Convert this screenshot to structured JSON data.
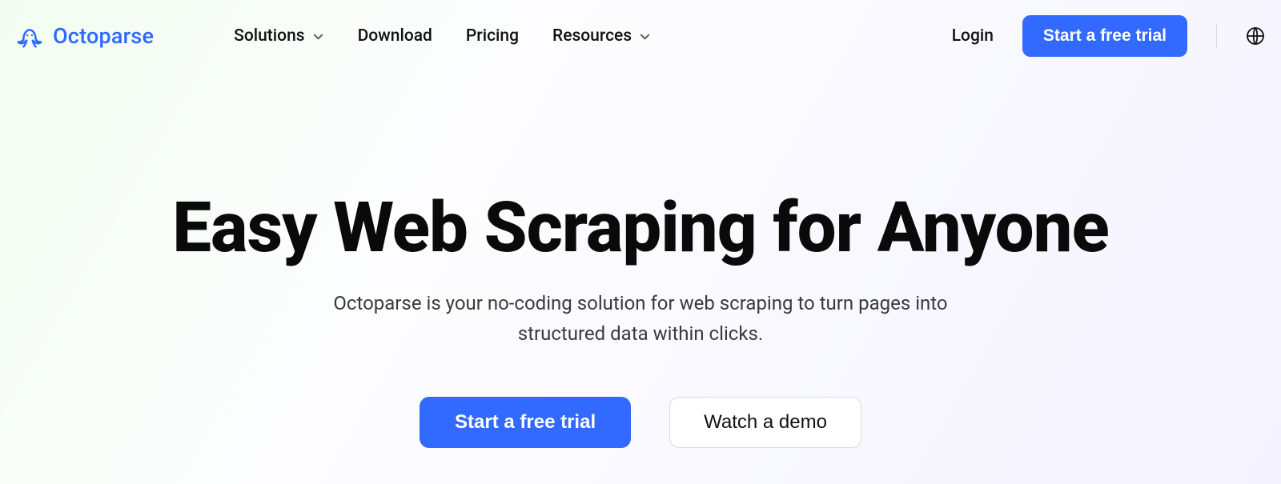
{
  "brand": {
    "name": "Octoparse"
  },
  "nav": {
    "solutions": "Solutions",
    "download": "Download",
    "pricing": "Pricing",
    "resources": "Resources"
  },
  "header": {
    "login": "Login",
    "cta": "Start a free trial"
  },
  "hero": {
    "title": "Easy Web Scraping for Anyone",
    "subtitle": "Octoparse is your no-coding solution for web scraping to turn pages into structured data within clicks.",
    "primary_cta": "Start a free trial",
    "secondary_cta": "Watch a demo"
  }
}
